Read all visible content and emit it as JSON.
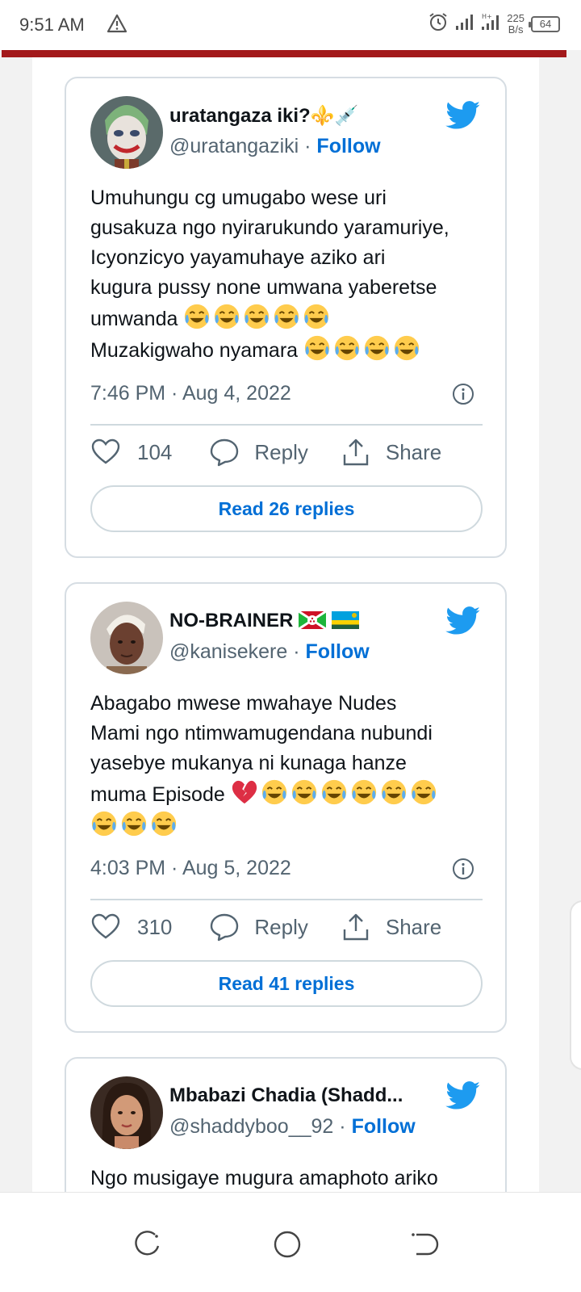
{
  "status_bar": {
    "time": "9:51 AM",
    "net_speed_value": "225",
    "net_speed_unit": "B/s",
    "battery": "64",
    "icons": [
      "warning-icon",
      "alarm-icon",
      "signal-icon",
      "hplus-signal-icon",
      "battery-icon"
    ]
  },
  "tweets": [
    {
      "display_name": "uratangaza iki?⚜️💉",
      "handle": "@uratangaziki",
      "follow_label": "Follow",
      "text_lines": [
        "Umuhungu cg umugabo wese uri",
        "gusakuza ngo nyirarukundo yaramuriye,",
        "Icyonzicyo yayamuhaye aziko ari",
        "kugura pussy none umwana yaberetse",
        "umwanda",
        "Muzakigwaho nyamara"
      ],
      "timestamp": "7:46 PM · Aug 4, 2022",
      "likes": "104",
      "reply_label": "Reply",
      "share_label": "Share",
      "read_replies_label": "Read 26 replies"
    },
    {
      "display_name": "NO-BRAINER",
      "handle": "@kanisekere",
      "follow_label": "Follow",
      "text_lines": [
        "Abagabo mwese mwahaye Nudes",
        "Mami ngo ntimwamugendana nubundi",
        "yasebye mukanya ni kunaga hanze",
        "muma Episode"
      ],
      "timestamp": "4:03 PM · Aug 5, 2022",
      "likes": "310",
      "reply_label": "Reply",
      "share_label": "Share",
      "read_replies_label": "Read 41 replies"
    },
    {
      "display_name": "Mbabazi Chadia (Shadd...",
      "handle": "@shaddyboo__92",
      "follow_label": "Follow",
      "text_lines": [
        "Ngo musigaye mugura amaphoto ariko"
      ]
    }
  ],
  "colors": {
    "accent_blue": "#006fd6",
    "twitter_blue": "#1d9bf0",
    "header_red": "#a3191b",
    "muted_text": "#536471",
    "border": "#cfd9de"
  }
}
